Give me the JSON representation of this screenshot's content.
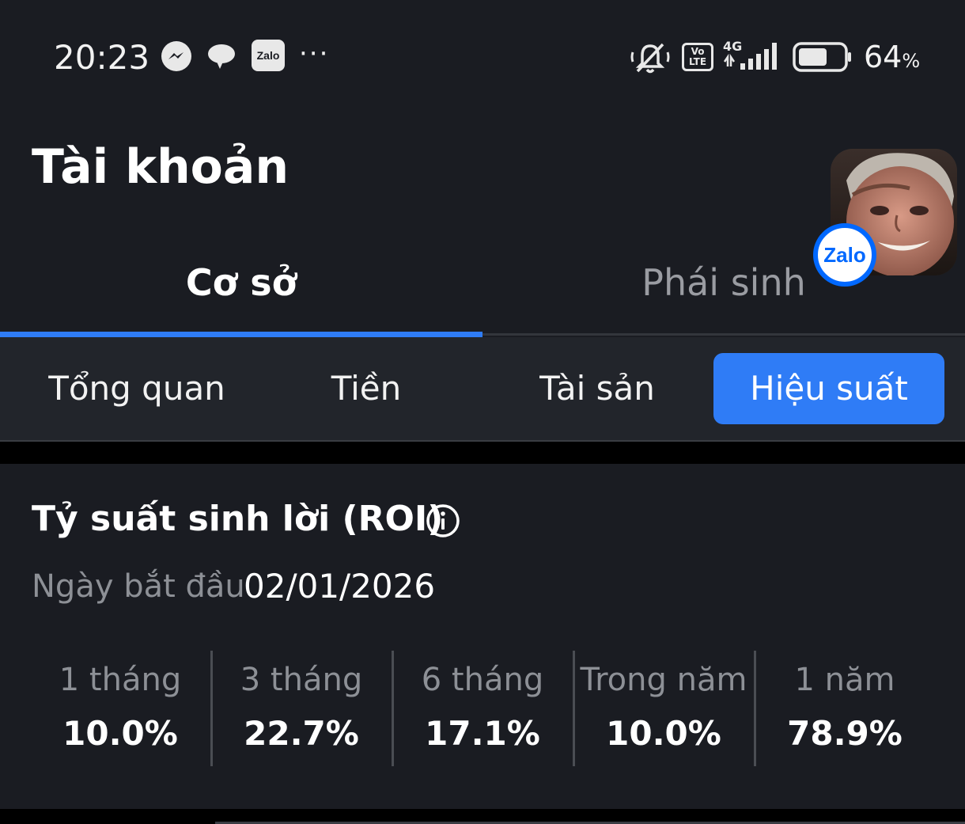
{
  "status_bar": {
    "time": "20:23",
    "zalo_icon_text": "Zalo",
    "more": "···",
    "volte_text_top": "Vo",
    "volte_text_bottom": "LTE",
    "network": "4G",
    "battery_percent": "64",
    "battery_level": 0.64,
    "percent_sign": "%",
    "icons": [
      "messenger-icon",
      "chat-bubble-icon",
      "zalo-icon",
      "mute-icon",
      "volte-icon",
      "signal-icon",
      "battery-icon"
    ]
  },
  "header": {
    "title": "Tài khoản",
    "badge_text": "Zalo"
  },
  "main_tabs": [
    {
      "label": "Cơ sở",
      "active": true
    },
    {
      "label": "Phái sinh",
      "active": false
    }
  ],
  "sub_tabs": [
    {
      "label": "Tổng quan",
      "active": false
    },
    {
      "label": "Tiền",
      "active": false
    },
    {
      "label": "Tài sản",
      "active": false
    },
    {
      "label": "Hiệu suất",
      "active": true
    }
  ],
  "roi": {
    "title": "Tỷ suất sinh lời (ROI)",
    "start_label": "Ngày bắt đầu",
    "start_date": "02/01/2026",
    "periods": [
      {
        "label": "1 tháng",
        "value": "10.0%"
      },
      {
        "label": "3 tháng",
        "value": "22.7%"
      },
      {
        "label": "6 tháng",
        "value": "17.1%"
      },
      {
        "label": "Trong năm",
        "value": "10.0%"
      },
      {
        "label": "1 năm",
        "value": "78.9%"
      }
    ]
  },
  "colors": {
    "accent": "#2f7cf6",
    "background": "#1a1c22",
    "subtab_background": "#22252b",
    "muted_text": "#8d9096",
    "zalo_blue": "#0068ff"
  }
}
